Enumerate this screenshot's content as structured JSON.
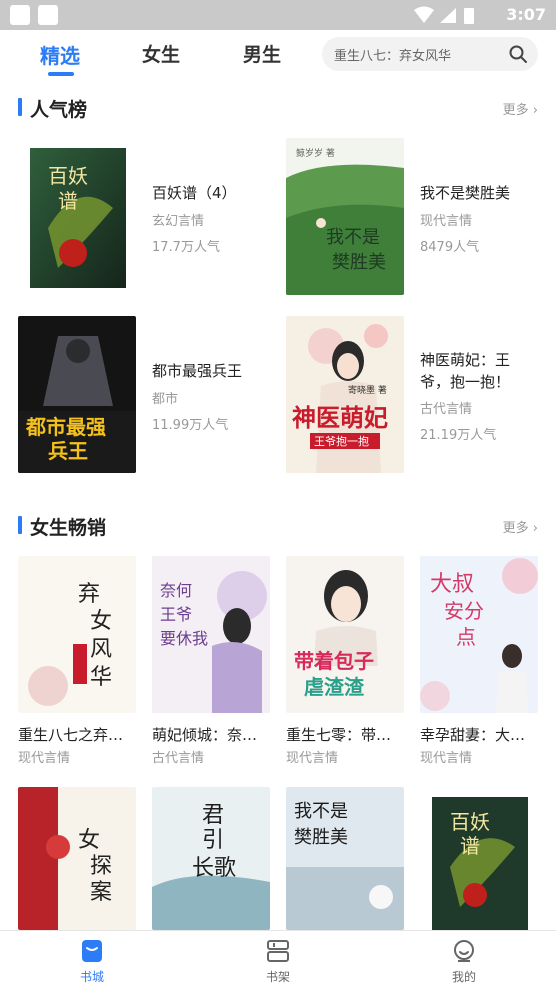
{
  "status_bar": {
    "time": "3:07"
  },
  "tabs": [
    {
      "label": "精选",
      "active": true
    },
    {
      "label": "女生",
      "active": false
    },
    {
      "label": "男生",
      "active": false
    }
  ],
  "search": {
    "placeholder": "重生八七：弃女风华"
  },
  "popular": {
    "title": "人气榜",
    "more": "更多",
    "books": [
      {
        "title": "百妖谱（4）",
        "category": "玄幻言情",
        "popularity": "17.7万人气",
        "cover_text": "百妖谱"
      },
      {
        "title": "我不是樊胜美",
        "category": "现代言情",
        "popularity": "8479人气",
        "cover_text": "我不是樊胜美",
        "cover_author": "鲸岁岁 著"
      },
      {
        "title": "都市最强兵王",
        "category": "都市",
        "popularity": "11.99万人气",
        "cover_text": "都市最强兵王"
      },
      {
        "title_line1": "神医萌妃：王",
        "title_line2": "爷，抱一抱！",
        "category": "古代言情",
        "popularity": "21.19万人气",
        "cover_text": "神医萌妃",
        "cover_sub": "王爷抱一抱",
        "cover_author": "寄晓墨 著"
      }
    ]
  },
  "female": {
    "title": "女生畅销",
    "more": "更多",
    "books": [
      {
        "title": "重生八七之弃…",
        "category": "现代言情",
        "cover_text": "弃女风华"
      },
      {
        "title": "萌妃倾城：奈…",
        "category": "古代言情",
        "cover_text": "奈何王爷要休我"
      },
      {
        "title": "重生七零：带…",
        "category": "现代言情",
        "cover_text": "带着包子虐渣渣"
      },
      {
        "title": "幸孕甜妻：大…",
        "category": "现代言情",
        "cover_text": "大叔安分点"
      }
    ],
    "row2_covers": [
      {
        "cover_text": "女探案"
      },
      {
        "cover_text": "君引长歌"
      },
      {
        "cover_text": "我不是樊胜美"
      },
      {
        "cover_text": "百妖谱"
      }
    ]
  },
  "bottom_nav": [
    {
      "label": "书城",
      "active": true,
      "icon": "bookstore-icon"
    },
    {
      "label": "书架",
      "active": false,
      "icon": "bookshelf-icon"
    },
    {
      "label": "我的",
      "active": false,
      "icon": "profile-icon"
    }
  ],
  "colors": {
    "accent": "#2b7cf6",
    "muted": "#999999"
  }
}
